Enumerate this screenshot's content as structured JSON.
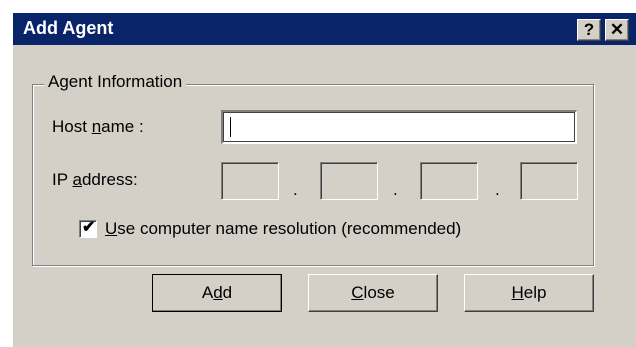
{
  "window": {
    "title": "Add Agent",
    "help_button": "?",
    "close_button": "✕"
  },
  "group": {
    "legend": "Agent Information"
  },
  "host": {
    "label_pre": "Host ",
    "label_mnemonic": "n",
    "label_post": "ame :",
    "value": ""
  },
  "ip": {
    "label_pre": "IP ",
    "label_mnemonic": "a",
    "label_post": "ddress:",
    "octets": [
      "",
      "",
      "",
      ""
    ],
    "separator": "."
  },
  "resolution": {
    "checked": true,
    "check_glyph": "✔",
    "label_mnemonic": "U",
    "label_post": "se computer name resolution  (recommended)"
  },
  "buttons": {
    "add": {
      "pre": "A",
      "mnemonic": "d",
      "post": "d"
    },
    "close": {
      "pre": "",
      "mnemonic": "C",
      "post": "lose"
    },
    "help": {
      "pre": "",
      "mnemonic": "H",
      "post": "elp"
    }
  },
  "colors": {
    "titlebar": "#0a246a",
    "dialog_face": "#d4d0c8"
  }
}
